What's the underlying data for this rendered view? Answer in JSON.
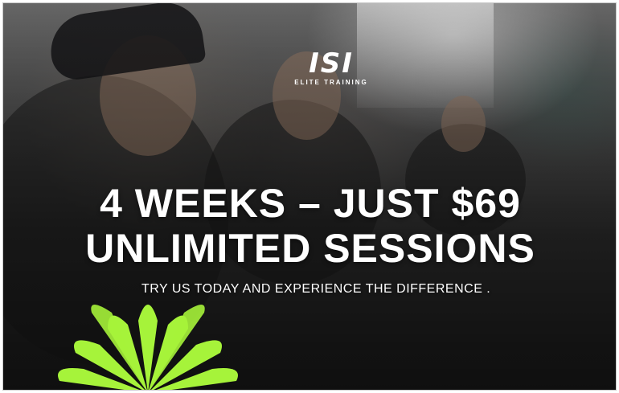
{
  "brand": {
    "logo_text": "ISI",
    "logo_sub": "ELITE TRAINING"
  },
  "promo": {
    "headline_line1": "4 WEEKS – JUST $69",
    "headline_line2": "UNLIMITED SESSIONS",
    "subline": "TRY US TODAY AND EXPERIENCE THE DIFFERENCE ."
  },
  "colors": {
    "text": "#ffffff",
    "palm": "#a6f33a"
  },
  "icons": {
    "decoration": "palm-leaves-icon"
  }
}
